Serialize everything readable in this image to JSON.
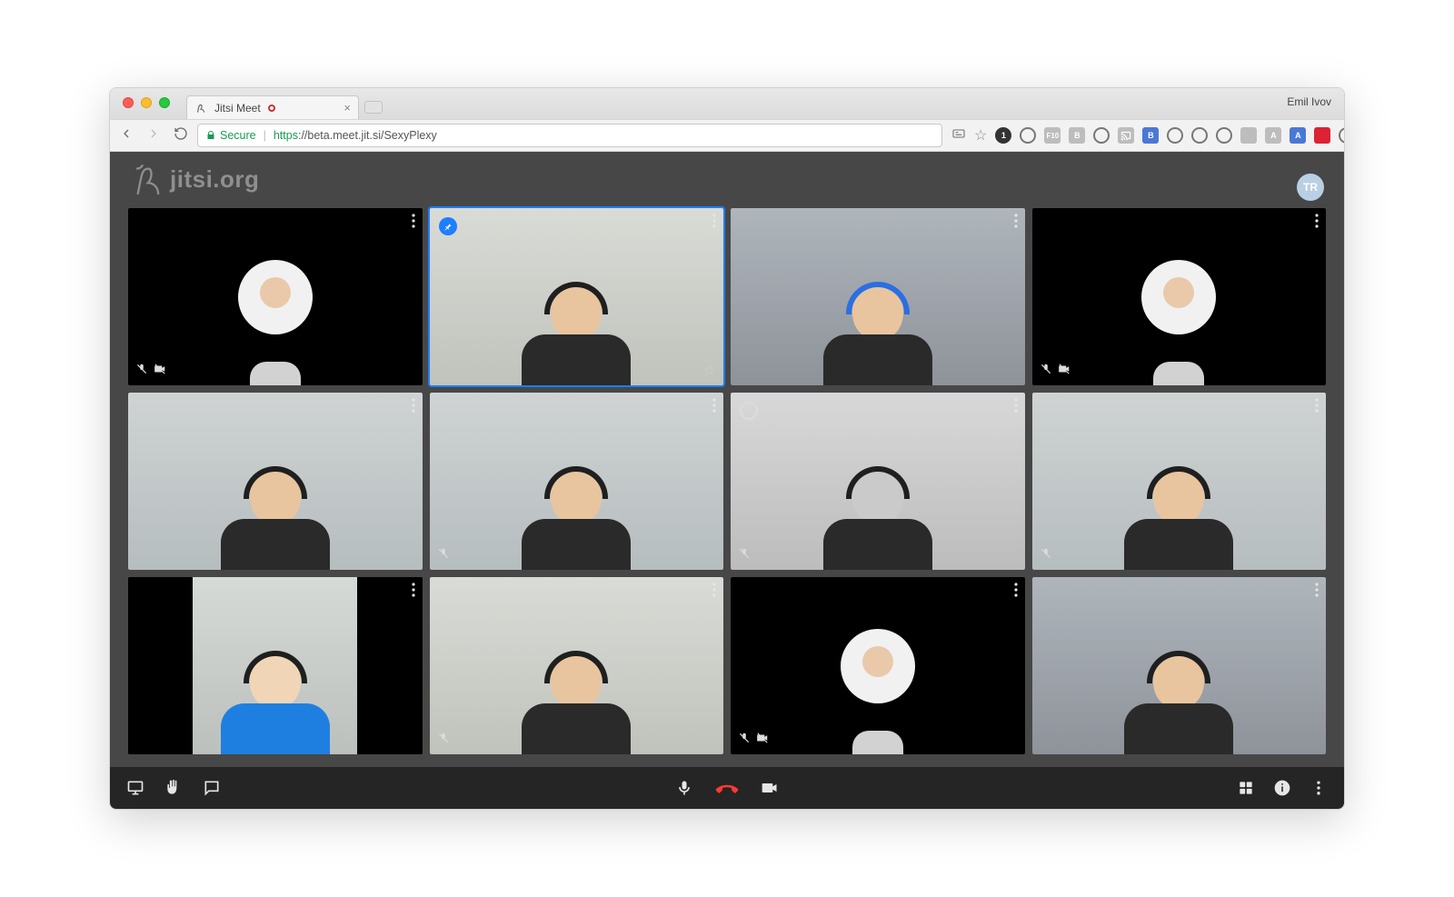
{
  "browser": {
    "profile_name": "Emil Ivov",
    "tab": {
      "title": "Jitsi Meet"
    },
    "addr": {
      "secure_label": "Secure",
      "scheme": "https",
      "host_path": "://beta.meet.jit.si/SexyPlexy"
    },
    "extensions": [
      {
        "name": "bookmark-icon",
        "style": "ring"
      },
      {
        "name": "ext-circle-1",
        "style": "dk circle",
        "label": "1"
      },
      {
        "name": "ext-bolt",
        "style": "ring"
      },
      {
        "name": "ext-f10",
        "style": "grey",
        "label": "F10"
      },
      {
        "name": "ext-b",
        "style": "grey",
        "label": "B"
      },
      {
        "name": "ext-dot",
        "style": "ring"
      },
      {
        "name": "ext-cast",
        "style": "grey",
        "label": ""
      },
      {
        "name": "ext-bb",
        "style": "blue",
        "label": "B"
      },
      {
        "name": "ext-target",
        "style": "ring"
      },
      {
        "name": "ext-o2",
        "style": "ring"
      },
      {
        "name": "ext-chat",
        "style": "ring"
      },
      {
        "name": "ext-sq",
        "style": "grey",
        "label": ""
      },
      {
        "name": "ext-a1",
        "style": "grey",
        "label": "A"
      },
      {
        "name": "ext-a2",
        "style": "blue",
        "label": "A"
      },
      {
        "name": "ext-red",
        "style": "dk",
        "label": ""
      },
      {
        "name": "ext-feather",
        "style": "ring"
      }
    ]
  },
  "app": {
    "logo_text": "jitsi.org",
    "self_avatar_initials": "TR",
    "participants": [
      {
        "id": "p1",
        "display": "avatar",
        "muted": true,
        "cam_off": true
      },
      {
        "id": "p2",
        "display": "video",
        "highlight": true,
        "pinned": true,
        "bg": "room2",
        "starred": true
      },
      {
        "id": "p3",
        "display": "video",
        "bg": "dim",
        "hp": "blue"
      },
      {
        "id": "p4",
        "display": "avatar",
        "muted": true,
        "cam_off": true
      },
      {
        "id": "p5",
        "display": "video",
        "bg": "room"
      },
      {
        "id": "p6",
        "display": "video",
        "bg": "room",
        "muted": true
      },
      {
        "id": "p7",
        "display": "video",
        "bg": "bw",
        "muted": true,
        "circle_marker": true
      },
      {
        "id": "p8",
        "display": "video",
        "bg": "room",
        "muted": true
      },
      {
        "id": "p9",
        "display": "portrait",
        "torso": "blue"
      },
      {
        "id": "p10",
        "display": "video",
        "bg": "room2",
        "muted": true
      },
      {
        "id": "p11",
        "display": "avatar",
        "muted": true,
        "cam_off": true
      },
      {
        "id": "p12",
        "display": "video",
        "bg": "dim"
      }
    ],
    "toolbar": {
      "left": [
        "screen-share",
        "raise-hand",
        "chat"
      ],
      "center": [
        "mic",
        "hangup",
        "camera"
      ],
      "right": [
        "tile-view",
        "info",
        "more"
      ]
    }
  }
}
